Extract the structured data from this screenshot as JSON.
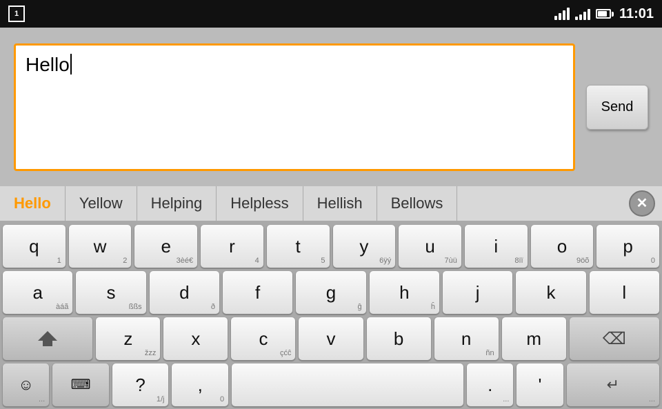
{
  "status_bar": {
    "notification_number": "1",
    "time": "11:01"
  },
  "input_area": {
    "text_value": "Hello",
    "send_label": "Send"
  },
  "suggestions": {
    "items": [
      {
        "label": "Hello",
        "active": true
      },
      {
        "label": "Yellow",
        "active": false
      },
      {
        "label": "Helping",
        "active": false
      },
      {
        "label": "Helpless",
        "active": false
      },
      {
        "label": "Hellish",
        "active": false
      },
      {
        "label": "Bellows",
        "active": false
      }
    ],
    "close_label": "×"
  },
  "keyboard": {
    "row1": [
      {
        "main": "q",
        "sub": "1"
      },
      {
        "main": "w",
        "sub": "2"
      },
      {
        "main": "e",
        "sub": "3èé€"
      },
      {
        "main": "r",
        "sub": "4"
      },
      {
        "main": "t",
        "sub": "5"
      },
      {
        "main": "y",
        "sub": "6ÿý"
      },
      {
        "main": "u",
        "sub": "7ùü"
      },
      {
        "main": "i",
        "sub": "8ïï"
      },
      {
        "main": "o",
        "sub": "9öõ"
      },
      {
        "main": "p",
        "sub": "0"
      }
    ],
    "row2": [
      {
        "main": "a",
        "sub": "àáã"
      },
      {
        "main": "s",
        "sub": "ßßs"
      },
      {
        "main": "d",
        "sub": "ð"
      },
      {
        "main": "f",
        "sub": ""
      },
      {
        "main": "g",
        "sub": "ĝ"
      },
      {
        "main": "h",
        "sub": "ĥ"
      },
      {
        "main": "j",
        "sub": ""
      },
      {
        "main": "k",
        "sub": ""
      },
      {
        "main": "l",
        "sub": ""
      }
    ],
    "row3_left": "shift",
    "row3": [
      {
        "main": "z",
        "sub": "žzz"
      },
      {
        "main": "x",
        "sub": ""
      },
      {
        "main": "c",
        "sub": "çćĉ"
      },
      {
        "main": "v",
        "sub": ""
      },
      {
        "main": "b",
        "sub": ""
      },
      {
        "main": "n",
        "sub": "ñn"
      },
      {
        "main": "m",
        "sub": ""
      }
    ],
    "row3_right": "backspace",
    "row4": {
      "emoji_label": "☺",
      "emoji_sub": "...",
      "keyboard_label": "⌨",
      "question_label": "?",
      "question_sub": "1/j",
      "comma_label": ",",
      "comma_sub": "0",
      "space_label": "",
      "period_label": ".",
      "period_sub": "...",
      "quote_label": "'",
      "enter_label": "↵",
      "enter_sub": "..."
    }
  }
}
